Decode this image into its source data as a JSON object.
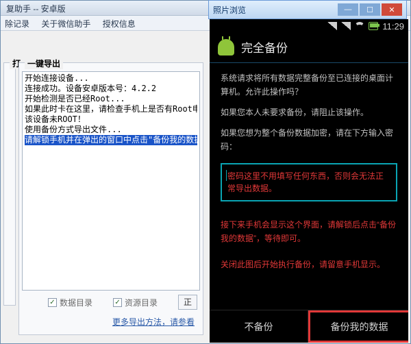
{
  "app": {
    "title": "复助手 -- 安卓版"
  },
  "menu": {
    "records": "除记录",
    "about": "关于微信助手",
    "authInfo": "授权信息"
  },
  "leftGroup": {
    "label": "打"
  },
  "mainGroup": {
    "label": "一键导出"
  },
  "log": {
    "lines": [
      "开始连接设备...",
      "连接成功。设备安卓版本号：4.2.2",
      "开始检测是否已经Root...",
      "如果此时卡在这里，请检查手机上是否有Root申请提示并点击确认...",
      "该设备未ROOT！",
      "使用备份方式导出文件...",
      "请解锁手机并在弹出的窗口中点击\"备份我的数据\"！"
    ]
  },
  "checkboxes": {
    "dataDir": "数据目录",
    "resDir": "资源目录"
  },
  "btn": {
    "right": "正"
  },
  "moreLink": "更多导出方法，请参看",
  "picWindow": {
    "title": "照片浏览"
  },
  "phone": {
    "time": "11:29",
    "headerTitle": "完全备份",
    "body1": "系统请求将所有数据完整备份至已连接的桌面计算机。允许此操作吗？",
    "body2": "如果您本人未要求备份，请阻止该操作。",
    "body3": "如果您想为整个备份数据加密，请在下方输入密码：",
    "passwordNote": "密码这里不用填写任何东西，否则会无法正常导出数据。",
    "note1": "接下来手机会显示这个界面，请解锁后点击“备份我的数据”，等待即可。",
    "note2": "关闭此图后开始执行备份，请留意手机显示。",
    "btnNo": "不备份",
    "btnYes": "备份我的数据"
  }
}
